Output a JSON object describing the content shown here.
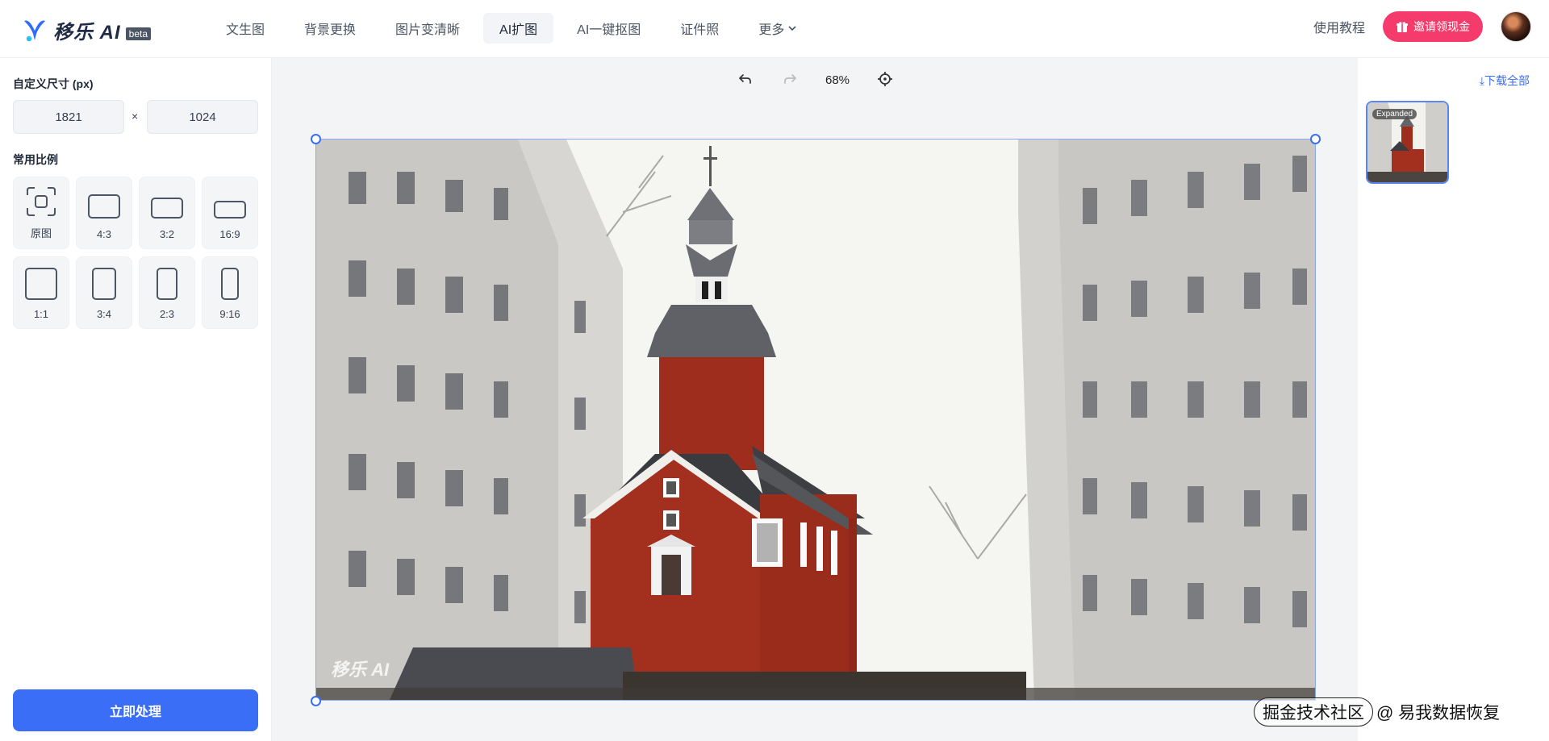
{
  "header": {
    "logo_text": "移乐 AI",
    "logo_badge": "beta",
    "nav": [
      {
        "label": "文生图"
      },
      {
        "label": "背景更换"
      },
      {
        "label": "图片变清晰"
      },
      {
        "label": "AI扩图",
        "active": true
      },
      {
        "label": "AI一键抠图"
      },
      {
        "label": "证件照"
      },
      {
        "label": "更多"
      }
    ],
    "tutorial": "使用教程",
    "invite_button": "邀请领现金"
  },
  "sidebar": {
    "custom_size_title": "自定义尺寸 (px)",
    "width_value": "1821",
    "height_value": "1024",
    "times": "×",
    "ratio_title": "常用比例",
    "ratios": [
      {
        "label": "原图"
      },
      {
        "label": "4:3"
      },
      {
        "label": "3:2"
      },
      {
        "label": "16:9"
      },
      {
        "label": "1:1"
      },
      {
        "label": "3:4"
      },
      {
        "label": "2:3"
      },
      {
        "label": "9:16"
      }
    ],
    "process_button": "立即处理"
  },
  "canvas": {
    "zoom": "68%",
    "image_watermark": "移乐 AI"
  },
  "right_panel": {
    "download_all": "下载全部",
    "thumb_badge": "Expanded"
  },
  "page_watermark": {
    "pill": "掘金技术社区",
    "text": "@ 易我数据恢复"
  },
  "colors": {
    "accent": "#3b6ef6",
    "invite": "#f53b6b",
    "canvas_bg": "#f3f4f6"
  }
}
